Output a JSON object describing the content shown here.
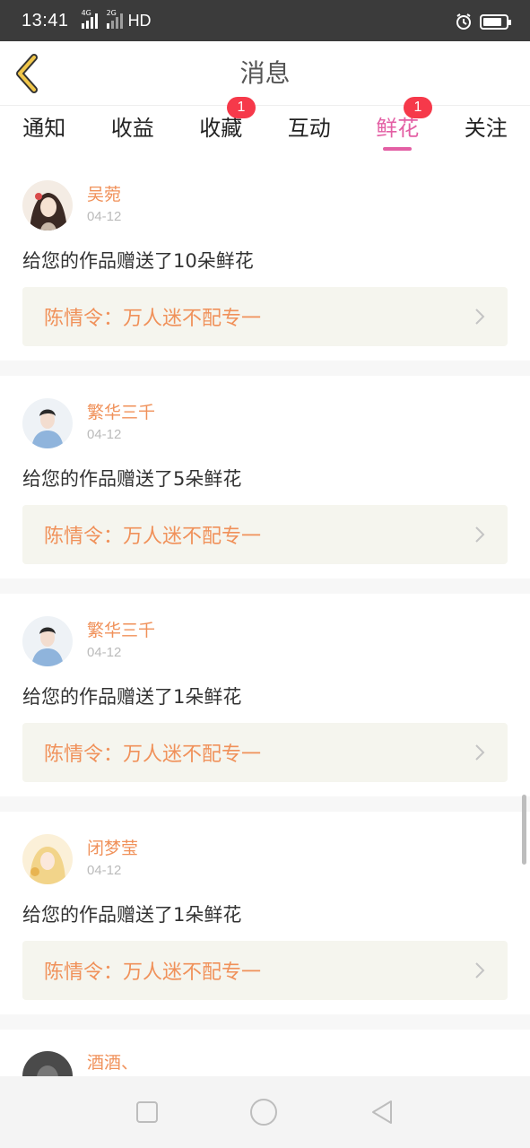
{
  "status_bar": {
    "time": "13:41",
    "net1": "4G",
    "net2": "2G",
    "hd": "HD"
  },
  "header": {
    "title": "消息",
    "back_icon": "chevron-left-icon",
    "accent": "#e35fa4"
  },
  "tabs": [
    {
      "label": "通知",
      "badge": ""
    },
    {
      "label": "收益",
      "badge": ""
    },
    {
      "label": "收藏",
      "badge": "1"
    },
    {
      "label": "互动",
      "badge": ""
    },
    {
      "label": "鲜花",
      "badge": "1",
      "active": true
    },
    {
      "label": "关注",
      "badge": ""
    }
  ],
  "messages": [
    {
      "name": "吴菀",
      "date": "04-12",
      "text": "给您的作品赠送了10朵鲜花",
      "work": "陈情令：万人迷不配专一"
    },
    {
      "name": "繁华三千",
      "date": "04-12",
      "text": "给您的作品赠送了5朵鲜花",
      "work": "陈情令：万人迷不配专一"
    },
    {
      "name": "繁华三千",
      "date": "04-12",
      "text": "给您的作品赠送了1朵鲜花",
      "work": "陈情令：万人迷不配专一"
    },
    {
      "name": "闭梦莹",
      "date": "04-12",
      "text": "给您的作品赠送了1朵鲜花",
      "work": "陈情令：万人迷不配专一"
    },
    {
      "name": "酒酒、",
      "date": "",
      "text": "",
      "work": ""
    }
  ]
}
